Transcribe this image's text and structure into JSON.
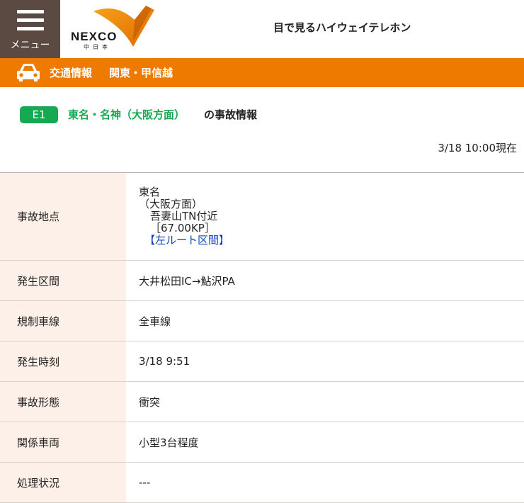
{
  "header": {
    "menu_label": "メニュー",
    "logo_text": "NEXCO",
    "logo_sub": "中日本",
    "site_title": "目で見るハイウェイテレホン"
  },
  "traffic_bar": {
    "section": "交通情報",
    "region": "関東・甲信越"
  },
  "road": {
    "badge": "E1",
    "name": "東名・名神（大阪方面）",
    "suffix": "の事故情報"
  },
  "timestamp": "3/18 10:00現在",
  "details": {
    "location": {
      "label": "事故地点",
      "line1": "東名",
      "line2": "（大阪方面）",
      "line3": "吾妻山TN付近",
      "line4": "［67.00KP］",
      "link": "【左ルート区間】"
    },
    "section": {
      "label": "発生区間",
      "value": "大井松田IC→鮎沢PA"
    },
    "lanes": {
      "label": "規制車線",
      "value": "全車線"
    },
    "time": {
      "label": "発生時刻",
      "value": "3/18 9:51"
    },
    "type": {
      "label": "事故形態",
      "value": "衝突"
    },
    "vehicles": {
      "label": "関係車両",
      "value": "小型3台程度"
    },
    "status": {
      "label": "処理状況",
      "value": "---"
    }
  },
  "colors": {
    "brand_orange": "#ef7a00",
    "menu_brown": "#5a4a42",
    "road_green": "#17a852",
    "label_bg": "#fcf0e9",
    "link_blue": "#1040c0"
  }
}
